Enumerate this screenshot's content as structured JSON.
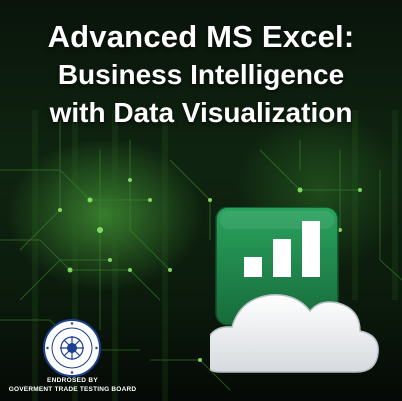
{
  "title": {
    "line1": "Advanced MS Excel:",
    "line2": "Business Intelligence",
    "line3": "with Data Visualization"
  },
  "endorsement": {
    "line1": "ENDROSED BY",
    "line2": "GOVERMENT TRADE TESTING BOARD",
    "seal_text": "TRADE TESTING BOARD"
  },
  "icons": {
    "main": "excel-cloud-chart-icon",
    "seal": "government-seal-icon"
  },
  "colors": {
    "title_text": "#ffffff",
    "brand_green": "#1f8a4c",
    "circuit_glow": "#5fd04a",
    "cloud": "#f2f4f6"
  }
}
